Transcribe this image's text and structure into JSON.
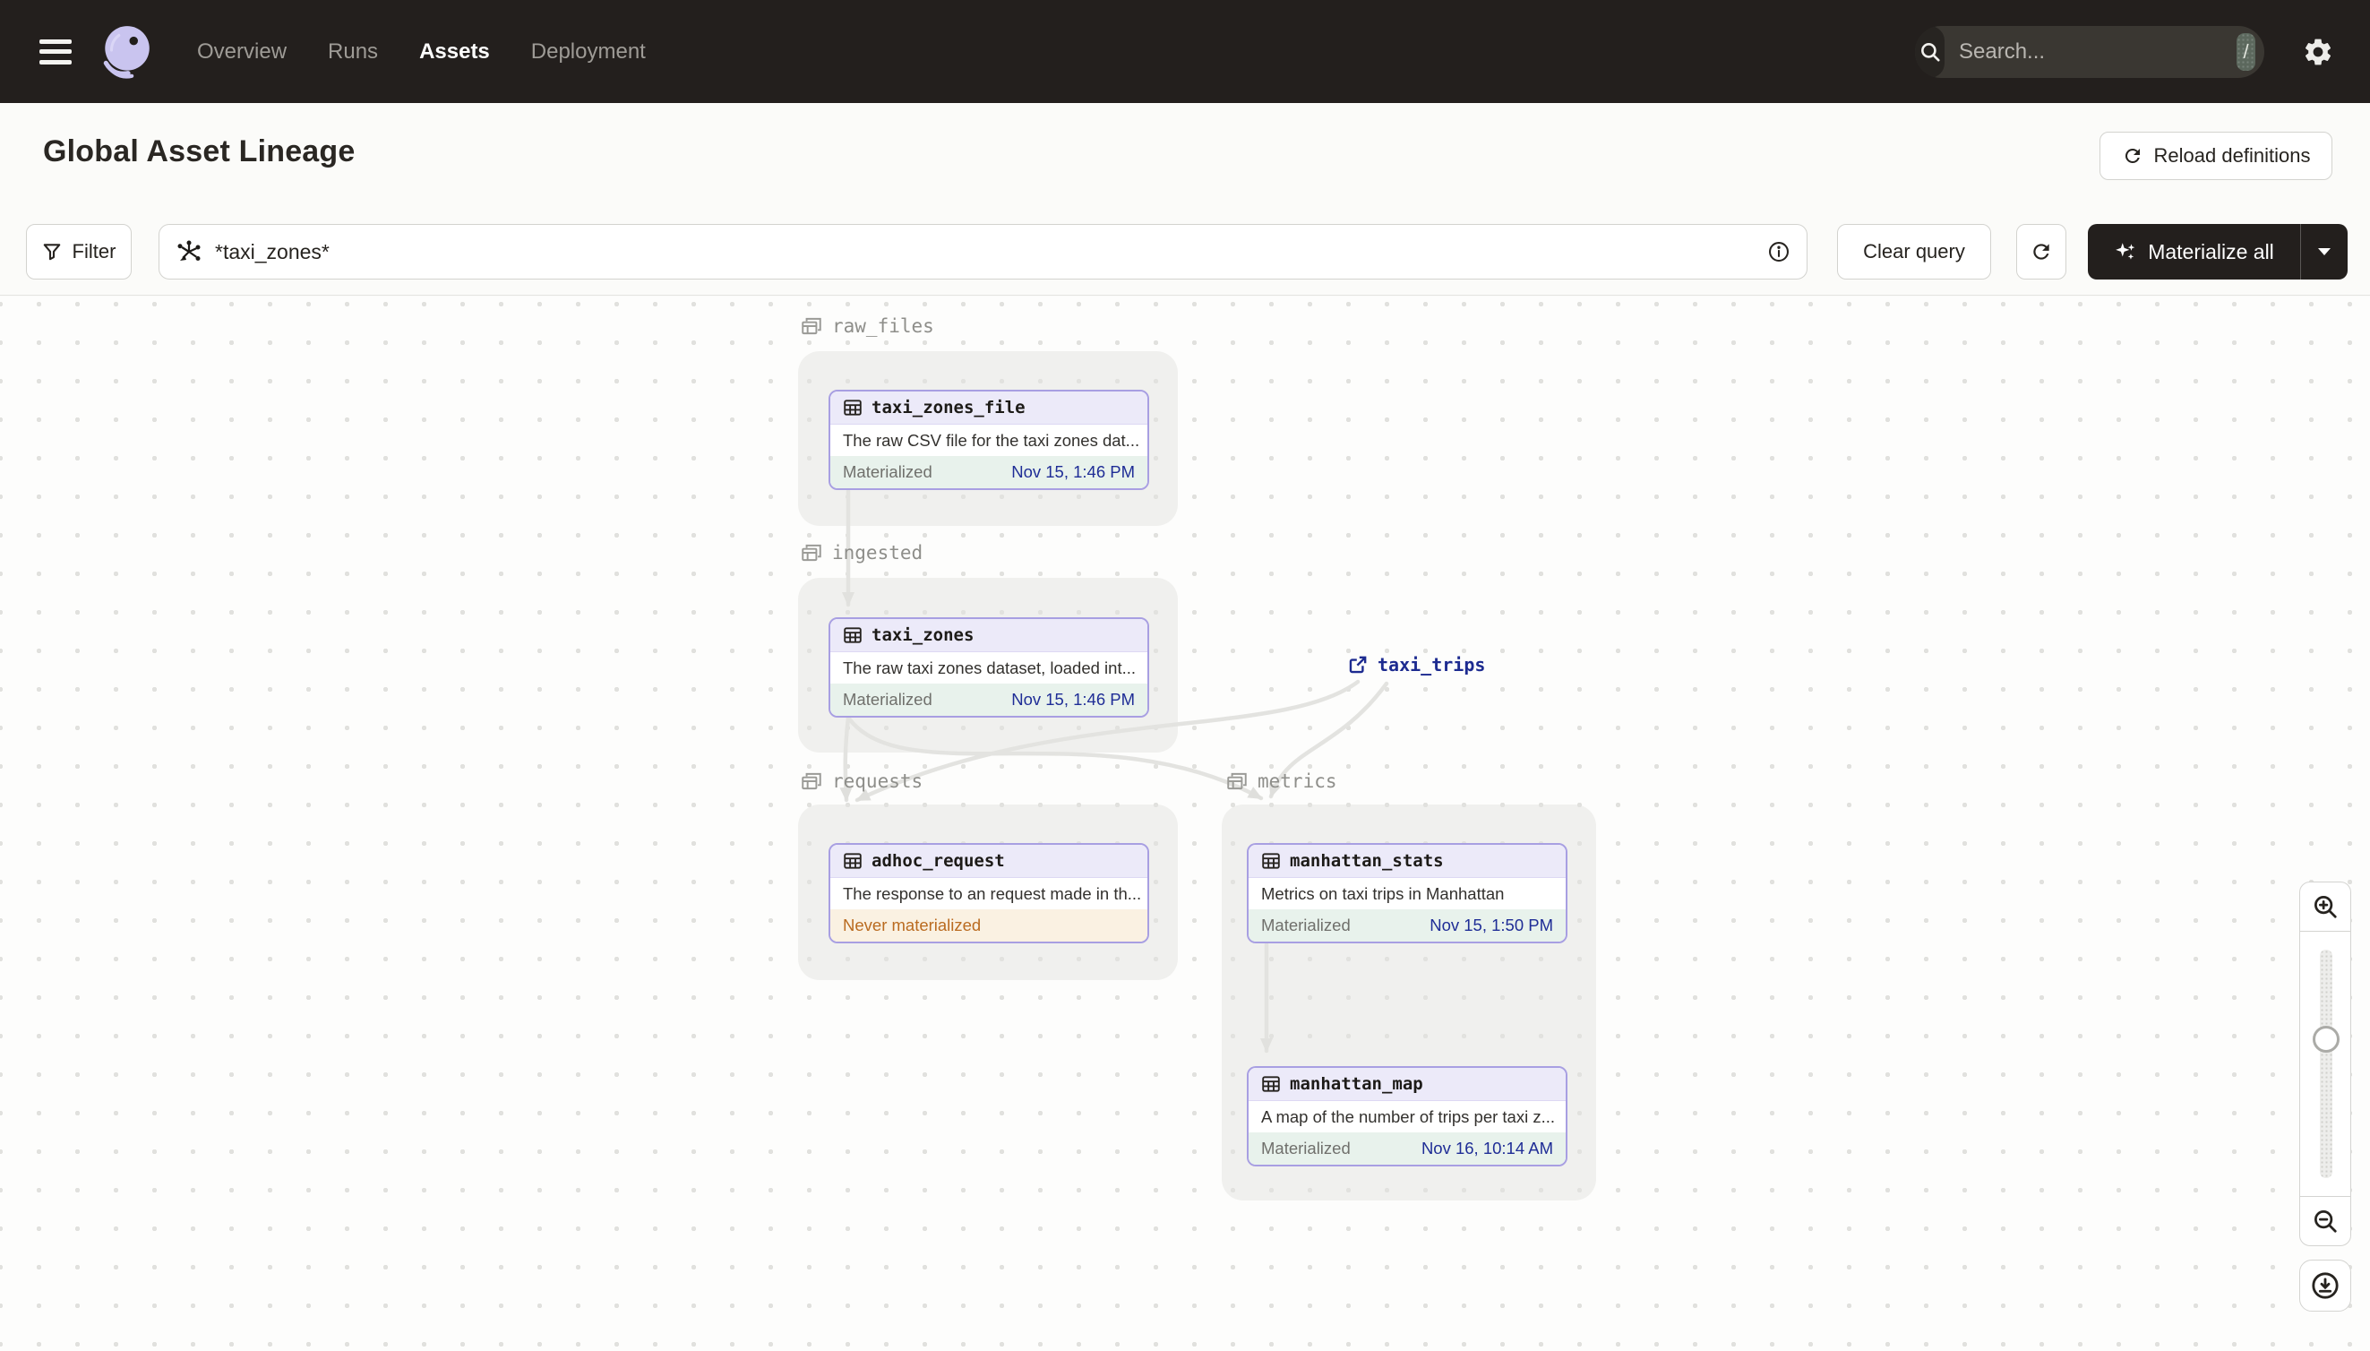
{
  "nav": {
    "items": [
      {
        "label": "Overview",
        "active": false
      },
      {
        "label": "Runs",
        "active": false
      },
      {
        "label": "Assets",
        "active": true
      },
      {
        "label": "Deployment",
        "active": false
      }
    ],
    "search": {
      "placeholder": "Search...",
      "shortcut_key": "/"
    }
  },
  "header": {
    "title": "Global Asset Lineage",
    "reload_button_label": "Reload definitions"
  },
  "toolbar": {
    "filter_label": "Filter",
    "query_value": "*taxi_zones*",
    "clear_query_label": "Clear query",
    "materialize_label": "Materialize all"
  },
  "graph": {
    "groups": [
      {
        "name": "raw_files"
      },
      {
        "name": "ingested"
      },
      {
        "name": "requests"
      },
      {
        "name": "metrics"
      }
    ],
    "nodes": [
      {
        "title": "taxi_zones_file",
        "description": "The raw CSV file for the taxi zones dat...",
        "status": "Materialized",
        "timestamp": "Nov 15, 1:46 PM"
      },
      {
        "title": "taxi_zones",
        "description": "The raw taxi zones dataset, loaded int...",
        "status": "Materialized",
        "timestamp": "Nov 15, 1:46 PM"
      },
      {
        "title": "adhoc_request",
        "description": "The response to an request made in th...",
        "status": "Never materialized",
        "timestamp": ""
      },
      {
        "title": "manhattan_stats",
        "description": "Metrics on taxi trips in Manhattan",
        "status": "Materialized",
        "timestamp": "Nov 15, 1:50 PM"
      },
      {
        "title": "manhattan_map",
        "description": "A map of the number of trips per taxi z...",
        "status": "Materialized",
        "timestamp": "Nov 16, 10:14 AM"
      }
    ],
    "external": {
      "label": "taxi_trips"
    }
  },
  "colors": {
    "nav_bg": "#231F1D",
    "accent_lavender": "#A89FE2",
    "materialized_bg": "#E8F2EC",
    "materialized_time": "#1F2D96",
    "never_materialized_bg": "#FAF1E2",
    "never_materialized_text": "#BA6B20",
    "edge": "#E3E3E0"
  }
}
